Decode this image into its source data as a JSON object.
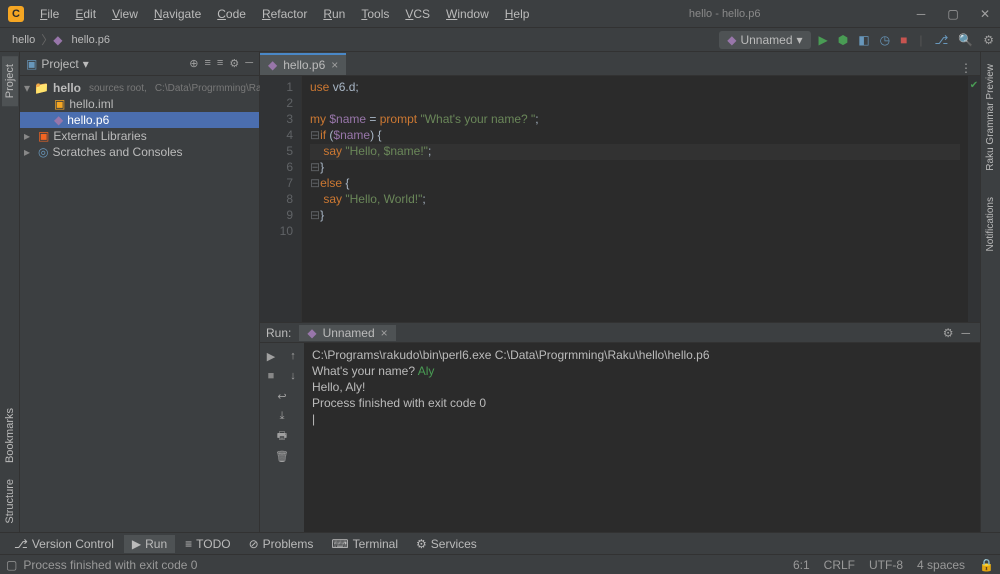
{
  "window": {
    "title": "hello - hello.p6"
  },
  "menu": [
    "File",
    "Edit",
    "View",
    "Navigate",
    "Code",
    "Refactor",
    "Run",
    "Tools",
    "VCS",
    "Window",
    "Help"
  ],
  "breadcrumb": [
    "hello",
    "hello.p6"
  ],
  "run_config": {
    "label": "Unnamed"
  },
  "project_panel": {
    "title": "Project",
    "root": {
      "name": "hello",
      "tag": "sources root,",
      "path": "C:\\Data\\Progrmming\\Raku\\hello"
    },
    "children": [
      {
        "name": "hello.iml",
        "type": "iml"
      },
      {
        "name": "hello.p6",
        "type": "raku",
        "selected": true
      }
    ],
    "external": "External Libraries",
    "scratches": "Scratches and Consoles"
  },
  "editor": {
    "tab": "hello.p6",
    "lines": [
      1,
      2,
      3,
      4,
      5,
      6,
      7,
      8,
      9,
      10
    ],
    "code": [
      {
        "t": [
          [
            "kw",
            "use"
          ],
          [
            "op",
            " v6"
          ],
          [
            "op",
            "."
          ],
          [
            "op",
            "d"
          ],
          [
            "op",
            ";"
          ]
        ]
      },
      {
        "t": []
      },
      {
        "t": [
          [
            "kw",
            "my"
          ],
          [
            "op",
            " "
          ],
          [
            "var",
            "$name"
          ],
          [
            "op",
            " = "
          ],
          [
            "kw",
            "prompt"
          ],
          [
            "op",
            " "
          ],
          [
            "str",
            "\"What's your name? \""
          ],
          [
            "op",
            ";"
          ]
        ]
      },
      {
        "t": [
          [
            "fold",
            "⊟"
          ],
          [
            "kw",
            "if"
          ],
          [
            "op",
            " ("
          ],
          [
            "var",
            "$name"
          ],
          [
            "op",
            ") {"
          ]
        ]
      },
      {
        "t": [
          [
            "op",
            "    "
          ],
          [
            "kw",
            "say"
          ],
          [
            "op",
            " "
          ],
          [
            "str",
            "\"Hello, $name!\""
          ],
          [
            "op",
            ";"
          ]
        ],
        "current": true
      },
      {
        "t": [
          [
            "fold",
            "⊟"
          ],
          [
            "op",
            "}"
          ]
        ]
      },
      {
        "t": [
          [
            "fold",
            "⊟"
          ],
          [
            "kw",
            "else"
          ],
          [
            "op",
            " {"
          ]
        ]
      },
      {
        "t": [
          [
            "op",
            "    "
          ],
          [
            "kw",
            "say"
          ],
          [
            "op",
            " "
          ],
          [
            "str",
            "\"Hello, World!\""
          ],
          [
            "op",
            ";"
          ]
        ]
      },
      {
        "t": [
          [
            "fold",
            "⊟"
          ],
          [
            "op",
            "}"
          ]
        ]
      },
      {
        "t": []
      }
    ]
  },
  "run_panel": {
    "label": "Run:",
    "tab": "Unnamed",
    "output": [
      {
        "text": "C:\\Programs\\rakudo\\bin\\perl6.exe C:\\Data\\Progrmming\\Raku\\hello\\hello.p6"
      },
      {
        "pre": "What's your name? ",
        "input": "Aly"
      },
      {
        "text": "Hello, Aly!"
      },
      {
        "text": ""
      },
      {
        "text": "Process finished with exit code 0"
      }
    ]
  },
  "bottom_tabs": [
    {
      "icon": "branch",
      "label": "Version Control"
    },
    {
      "icon": "play",
      "label": "Run",
      "active": true
    },
    {
      "icon": "list",
      "label": "TODO"
    },
    {
      "icon": "warn",
      "label": "Problems"
    },
    {
      "icon": "term",
      "label": "Terminal"
    },
    {
      "icon": "gear",
      "label": "Services"
    }
  ],
  "status": {
    "msg": "Process finished with exit code 0",
    "pos": "6:1",
    "eol": "CRLF",
    "enc": "UTF-8",
    "indent": "4 spaces"
  },
  "side_right": [
    "Raku Grammar Preview",
    "Notifications"
  ],
  "side_left": [
    "Project",
    "Bookmarks",
    "Structure"
  ]
}
